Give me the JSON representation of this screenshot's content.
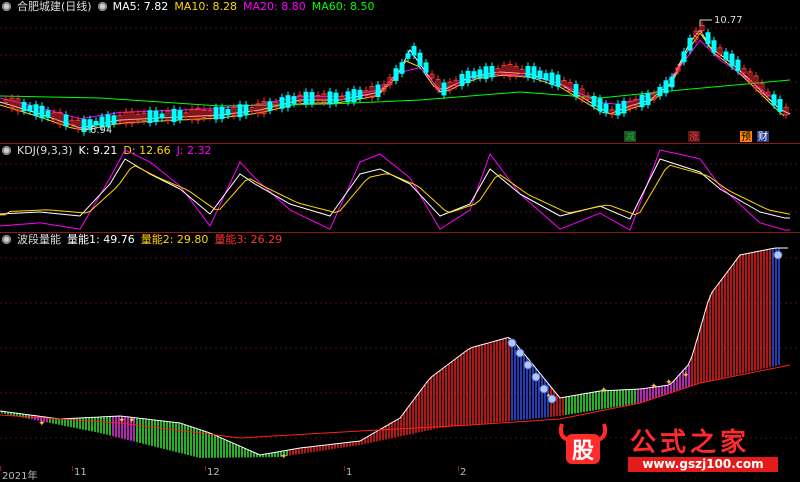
{
  "main": {
    "title": "合肥城建(日线)",
    "ma": [
      {
        "label": "MA5: 7.82",
        "color": "#ffffff"
      },
      {
        "label": "MA10: 8.28",
        "color": "#ffd700"
      },
      {
        "label": "MA20: 8.80",
        "color": "#ff00ff"
      },
      {
        "label": "MA60: 8.50",
        "color": "#00ff00"
      }
    ],
    "high_label": "10.77",
    "low_label": "6.94",
    "markers": [
      {
        "text": "减",
        "color": "#22aa44"
      },
      {
        "text": "涨",
        "color": "#ff3333"
      },
      {
        "text": "预",
        "color": "#ff8800"
      },
      {
        "text": "财",
        "color": "#3366ff"
      }
    ]
  },
  "kdj": {
    "title": "KDJ(9,3,3)",
    "k": "K: 9.21",
    "d": "D: 12.66",
    "j": "J: 2.32",
    "colors": {
      "k": "#ffffff",
      "d": "#ffd700",
      "j": "#ff00ff"
    }
  },
  "wave": {
    "title": "波段量能",
    "v1": "量能1: 49.76",
    "v2": "量能2: 29.80",
    "v3": "量能3: 26.29",
    "colors": {
      "v1": "#ffffff",
      "v2": "#ffd700",
      "v3": "#ff3333"
    }
  },
  "axis": {
    "labels": [
      "2021年",
      "11",
      "12",
      "1",
      "2"
    ]
  },
  "watermark": {
    "logo_char": "股",
    "title": "公式之家",
    "url": "www.gszj100.com"
  }
}
